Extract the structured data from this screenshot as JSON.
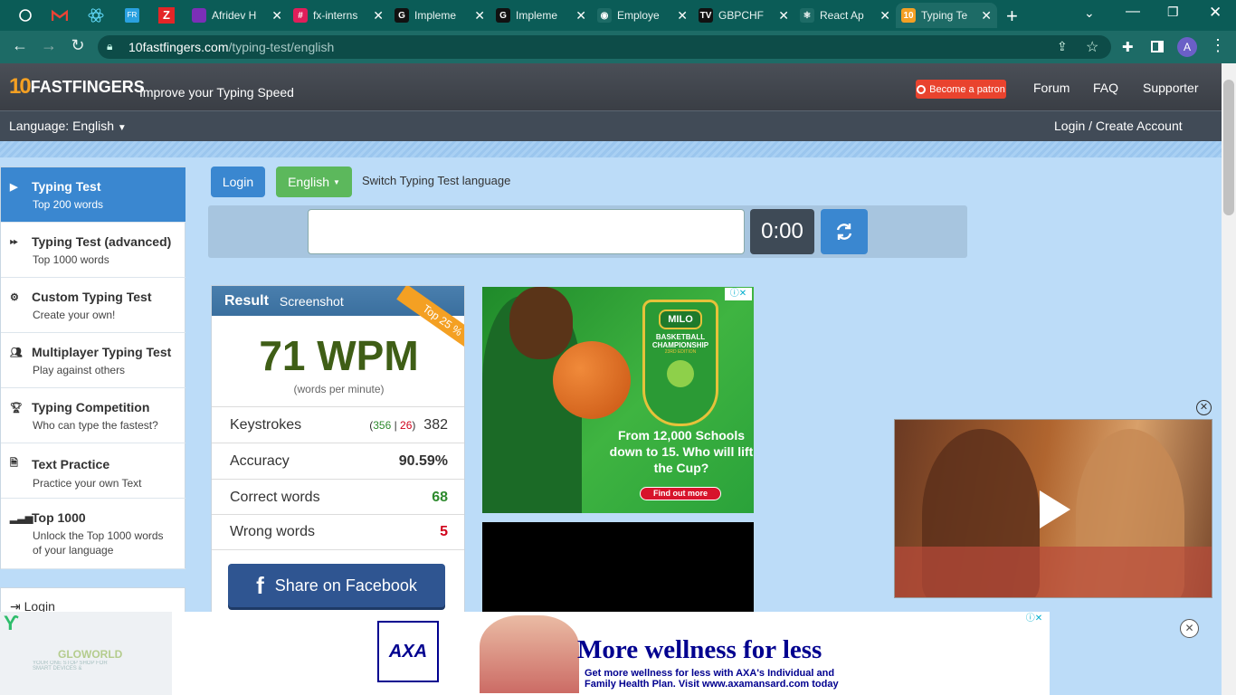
{
  "browser": {
    "tabs": [
      {
        "title": "Afridev H",
        "fav_color": "#7b2fb7",
        "fav_text": ""
      },
      {
        "title": "fx-interns",
        "fav_color": "#e01e5a",
        "fav_text": "#"
      },
      {
        "title": "Impleme",
        "fav_color": "#111111",
        "fav_text": "G"
      },
      {
        "title": "Impleme",
        "fav_color": "#111111",
        "fav_text": "G"
      },
      {
        "title": "Employe",
        "fav_color": "#1d6b66",
        "fav_text": "◉"
      },
      {
        "title": "GBPCHF",
        "fav_color": "#111111",
        "fav_text": "TV"
      },
      {
        "title": "React Ap",
        "fav_color": "#1d6b66",
        "fav_text": "⚛"
      },
      {
        "title": "Typing Te",
        "fav_color": "#f4a023",
        "fav_text": "10"
      }
    ],
    "url_host": "10fastfingers.com",
    "url_path": "/typing-test/english",
    "profile_initial": "A"
  },
  "header": {
    "logo_text": "FASTFINGERS",
    "logo_num": "10",
    "tagline": "Improve your Typing Speed",
    "patron": "Become a patron",
    "links": [
      "Forum",
      "FAQ",
      "Supporter"
    ],
    "language": "Language: English",
    "login": "Login / Create Account"
  },
  "sidebar": {
    "items": [
      {
        "title": "Typing Test",
        "sub": "Top 200 words",
        "icon": "play-icon"
      },
      {
        "title": "Typing Test (advanced)",
        "sub": "Top 1000 words",
        "icon": "fast-forward-icon"
      },
      {
        "title": "Custom Typing Test",
        "sub": "Create your own!",
        "icon": "gears-icon"
      },
      {
        "title": "Multiplayer Typing Test",
        "sub": "Play against others",
        "icon": "users-icon"
      },
      {
        "title": "Typing Competition",
        "sub": "Who can type the fastest?",
        "icon": "trophy-icon"
      },
      {
        "title": "Text Practice",
        "sub": "Practice your own Text",
        "icon": "document-icon"
      },
      {
        "title": "Top 1000",
        "sub": "Unlock the Top 1000 words",
        "sub2": "of your language",
        "icon": "signal-icon"
      }
    ],
    "login": "Login"
  },
  "controls": {
    "login": "Login",
    "language": "English",
    "switch_label": "Switch Typing Test language",
    "timer": "0:00"
  },
  "result": {
    "title": "Result",
    "screenshot": "Screenshot",
    "badge": "Top 25 %",
    "wpm": "71 WPM",
    "wpm_label": "(words per minute)",
    "keystrokes_label": "Keystrokes",
    "keystrokes_correct": "356",
    "keystrokes_wrong": "26",
    "keystrokes_total": "382",
    "accuracy_label": "Accuracy",
    "accuracy": "90.59%",
    "correct_label": "Correct words",
    "correct": "68",
    "wrong_label": "Wrong words",
    "wrong": "5",
    "share": "Share on Facebook"
  },
  "ads": {
    "milo_brand": "MILO",
    "milo_event": "BASKETBALL CHAMPIONSHIP",
    "milo_edition": "23RD EDITION",
    "milo_copy": "From 12,000 Schools down to 15. Who will lift the Cup?",
    "milo_cta": "Find out more",
    "axa_brand": "AXA",
    "axa_headline": "More wellness for less",
    "axa_copy1": "Get more wellness for less with AXA's Individual and",
    "axa_copy2": "Family Health Plan. Visit www.axamansard.com today",
    "left_ad": "GLOWORLD",
    "left_ad_sub": "YOUR ONE STOP SHOP FOR SMART DEVICES &"
  },
  "colors": {
    "accent": "#3a87d0",
    "green": "#5cb85c",
    "wpm": "#3f5e16"
  }
}
